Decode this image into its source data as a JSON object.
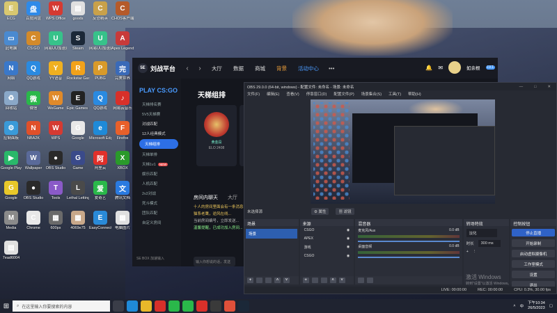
{
  "desktop": {
    "icons": [
      {
        "label": "ECG",
        "color": "#d8c870",
        "glyph": "E"
      },
      {
        "label": "百度网盘",
        "color": "#2f8ae8",
        "glyph": "盘"
      },
      {
        "label": "WPS Office",
        "color": "#d53a32",
        "glyph": "W"
      },
      {
        "label": "goods",
        "color": "#e0e0e0",
        "glyph": "▤"
      },
      {
        "label": "反恐精英",
        "color": "#c9a14a",
        "glyph": "C"
      },
      {
        "label": "CHOS客户端",
        "color": "#b55a2a",
        "glyph": "C"
      },
      {
        "label": "此电脑",
        "color": "#4a8ad0",
        "glyph": "▭"
      },
      {
        "label": "CS:GO",
        "color": "#d38a2a",
        "glyph": "C"
      },
      {
        "label": "网易UU加速器",
        "color": "#37c28a",
        "glyph": "U"
      },
      {
        "label": "Steam",
        "color": "#1b2838",
        "glyph": "S"
      },
      {
        "label": "网易UU加速器",
        "color": "#37c28a",
        "glyph": "U"
      },
      {
        "label": "Apex Legends",
        "color": "#c83a3a",
        "glyph": "A"
      },
      {
        "label": "网络",
        "color": "#3a78c9",
        "glyph": "N"
      },
      {
        "label": "QQ游戏",
        "color": "#2a8ae0",
        "glyph": "Q"
      },
      {
        "label": "YY语音",
        "color": "#f0b020",
        "glyph": "Y"
      },
      {
        "label": "Rockstar Games",
        "color": "#f2a21a",
        "glyph": "R"
      },
      {
        "label": "PUBG",
        "color": "#d89a2a",
        "glyph": "P"
      },
      {
        "label": "完美世界",
        "color": "#3a6ab8",
        "glyph": "完"
      },
      {
        "label": "回收站",
        "color": "#8aa8c8",
        "glyph": "♻"
      },
      {
        "label": "微信",
        "color": "#2ab84a",
        "glyph": "微"
      },
      {
        "label": "WeGame",
        "color": "#e08a2a",
        "glyph": "W"
      },
      {
        "label": "Epic Games Launcher",
        "color": "#222222",
        "glyph": "E"
      },
      {
        "label": "QQ游戏",
        "color": "#2a8ae0",
        "glyph": "Q"
      },
      {
        "label": "网易云音乐",
        "color": "#d8302a",
        "glyph": "♪"
      },
      {
        "label": "控制面板",
        "color": "#3a9ad8",
        "glyph": "⚙"
      },
      {
        "label": "NBA2K",
        "color": "#e0502a",
        "glyph": "N"
      },
      {
        "label": "WPS",
        "color": "#d53a32",
        "glyph": "W"
      },
      {
        "label": "Google",
        "color": "#e8e8e8",
        "glyph": "G"
      },
      {
        "label": "Microsoft Edge",
        "color": "#1f8ad8",
        "glyph": "e"
      },
      {
        "label": "Firefox",
        "color": "#e8602a",
        "glyph": "F"
      },
      {
        "label": "Google Play",
        "color": "#2ab86a",
        "glyph": "▶"
      },
      {
        "label": "Wallpaper",
        "color": "#5a6a9a",
        "glyph": "W"
      },
      {
        "label": "OBS Studio",
        "color": "#2a2a2a",
        "glyph": "●"
      },
      {
        "label": "Game",
        "color": "#3a4a8a",
        "glyph": "G"
      },
      {
        "label": "阿里云",
        "color": "#e0302a",
        "glyph": "阿"
      },
      {
        "label": "XBOX",
        "color": "#2a9a2a",
        "glyph": "X"
      },
      {
        "label": "Google",
        "color": "#e8c82a",
        "glyph": "G"
      },
      {
        "label": "OBS Studio",
        "color": "#2a2a2a",
        "glyph": "●"
      },
      {
        "label": "Tools",
        "color": "#8a5ac8",
        "glyph": "T"
      },
      {
        "label": "Lethal Letting Go",
        "color": "#4a4a4a",
        "glyph": "L"
      },
      {
        "label": "爱奇艺",
        "color": "#2ab84a",
        "glyph": "爱"
      },
      {
        "label": "腾讯文档",
        "color": "#2a7ae0",
        "glyph": "文"
      },
      {
        "label": "Media",
        "color": "#8a8a8a",
        "glyph": "M"
      },
      {
        "label": "Chrome",
        "color": "#e8e8e8",
        "glyph": "C"
      },
      {
        "label": "600px",
        "color": "#6a6a6a",
        "glyph": "▦"
      },
      {
        "label": "4069e75",
        "color": "#c8a88a",
        "glyph": "▦"
      },
      {
        "label": "EasyConnect",
        "color": "#2a8ad8",
        "glyph": "E"
      },
      {
        "label": "电脑图片",
        "color": "#e0e0e0",
        "glyph": "▦"
      },
      {
        "label": "7ead6004",
        "color": "#e0e0e0",
        "glyph": "▤"
      }
    ]
  },
  "game": {
    "logo_text": "刘战平台",
    "nav_tabs": [
      "大厅",
      "数据",
      "商城",
      "背景",
      "活动中心"
    ],
    "hot_tab": "背景",
    "active_tab": "活动中心",
    "more": "•••",
    "username": "如余根",
    "level_badge": "LV.1",
    "play_title": "PLAY CS:GO",
    "side_items": [
      {
        "label": "天梯排名赛",
        "type": "item"
      },
      {
        "label": "5V5天梯赛",
        "type": "item"
      },
      {
        "label": "对战匹配",
        "type": "group"
      },
      {
        "label": "12人经典模式",
        "type": "group"
      },
      {
        "label": "天梯组排",
        "type": "active"
      },
      {
        "label": "天梯单排",
        "type": "item"
      },
      {
        "label": "天梯1v1",
        "type": "item",
        "badge": "NEW"
      },
      {
        "label": "娱乐匹配",
        "type": "item"
      },
      {
        "label": "人机匹配",
        "type": "item"
      },
      {
        "label": "2v2对战",
        "type": "item"
      },
      {
        "label": "死斗模式",
        "type": "item"
      },
      {
        "label": "团队匹配",
        "type": "item"
      },
      {
        "label": "自定义房间",
        "type": "item"
      }
    ],
    "side_footer": "SE BOX  加速输入",
    "section_title": "天梯组排",
    "card_rank": "黄金段",
    "card_elo": "ELO 2408",
    "room_tab_1": "房间内聊天",
    "room_tab_2": "大厅",
    "chat": [
      "十人的房间里面会有一条消息...",
      "猫系老鹰，逆风在线...",
      "当前房间编号，立即发送...",
      "温馨提醒，已成功加入房间..."
    ],
    "chat_placeholder": "输入你想说的话，发送"
  },
  "obs": {
    "title": "OBS 29.0.0 (64-bit, windows) - 配置文件: 未命名 - 场景: 未命名",
    "menu": [
      "文件(F)",
      "编辑(E)",
      "查看(V)",
      "停靠窗口(D)",
      "配置文件(P)",
      "场景集合(S)",
      "工具(T)",
      "帮助(H)"
    ],
    "scene_bar_label": "未选择源",
    "scene_bar_btn1": "⚙ 属性",
    "scene_bar_btn2": "▦ 滤镜",
    "docks": {
      "scenes": "场景",
      "sources": "来源",
      "mixer": "混音器",
      "transitions": "转场特效",
      "controls": "控制按钮"
    },
    "scene_item": "场景",
    "sources": [
      "CSGO",
      "APEX",
      "游戏",
      "CSGO"
    ],
    "mixer_tracks": [
      {
        "name": "麦克风/Aux",
        "db": "0.0 dB"
      },
      {
        "name": "桌面音频",
        "db": "0.0 dB"
      }
    ],
    "transition_select": "淡化",
    "transition_duration_label": "时长",
    "transition_duration": "300 ms",
    "controls": [
      "停止直播",
      "开始录制",
      "启动虚拟摄像机",
      "工作室模式",
      "设置",
      "退出"
    ],
    "status_live": "LIVE: 00:00:00",
    "status_rec": "REC: 00:00:00",
    "status_cpu": "CPU: 0.3%, 30.00 fps",
    "watermark": "激活 Windows",
    "watermark_sub": "转到\"设置\"以激活 Windows。"
  },
  "taskbar": {
    "search_placeholder": "在这里输入你要搜索的内容",
    "time": "下午10:34",
    "date": "26/5/2023",
    "ime": "中"
  }
}
